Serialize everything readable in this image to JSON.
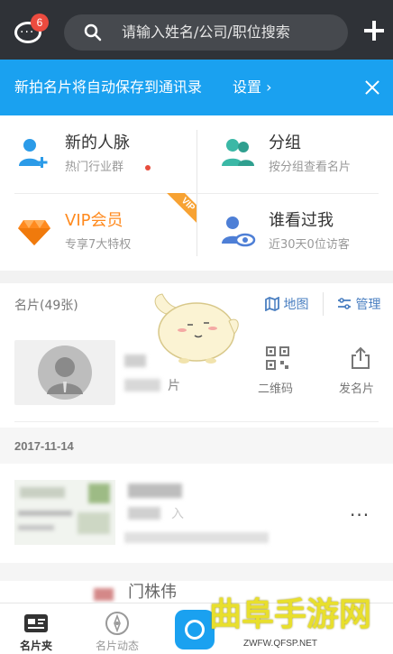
{
  "topbar": {
    "message_badge": "6",
    "search_placeholder": "请输入姓名/公司/职位搜索"
  },
  "banner": {
    "text": "新拍名片将自动保存到通讯录",
    "link": "设置 ›"
  },
  "grid": [
    {
      "title": "新的人脉",
      "sub": "热门行业群",
      "icon": "add-contact-icon"
    },
    {
      "title": "分组",
      "sub": "按分组查看名片",
      "icon": "group-icon"
    },
    {
      "title": "VIP会员",
      "sub": "专享7大特权",
      "icon": "diamond-icon",
      "ribbon": "VIP"
    },
    {
      "title": "谁看过我",
      "sub": "近30天0位访客",
      "icon": "visitor-eye-icon"
    }
  ],
  "cards": {
    "count_label": "名片(49张)",
    "map_label": "地图",
    "manage_label": "管理",
    "my_card_label": "片",
    "qr_label": "二维码",
    "send_label": "发名片"
  },
  "list": {
    "date": "2017-11-14",
    "contact1_fragment": "入",
    "contact2_name": "门株伟"
  },
  "tabbar": {
    "tab1": "名片夹",
    "tab2": "名片动态"
  },
  "watermark": {
    "main": "曲阜手游网",
    "sub": "ZWFW.QFSP.NET"
  },
  "colors": {
    "topbar": "#2f3237",
    "banner": "#1aa1f0",
    "vip": "#ff8a1e",
    "link": "#4a7fc1"
  }
}
